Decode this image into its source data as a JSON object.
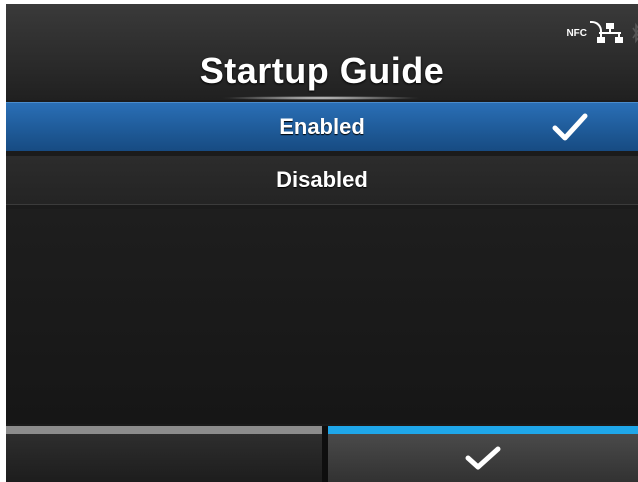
{
  "header": {
    "title": "Startup Guide",
    "status": {
      "nfc_label": "NFC",
      "icons": [
        "nfc-icon",
        "network-icon",
        "bluetooth-icon"
      ]
    }
  },
  "options": [
    {
      "label": "Enabled",
      "selected": true
    },
    {
      "label": "Disabled",
      "selected": false
    }
  ],
  "softkeys": {
    "left": {
      "label": ""
    },
    "right": {
      "icon": "check-icon"
    }
  },
  "colors": {
    "selected_row": "#1f5b99",
    "accent_bar": "#1fa7ea",
    "inactive_bar": "#8c8c8c",
    "background": "#1b1b1b"
  }
}
